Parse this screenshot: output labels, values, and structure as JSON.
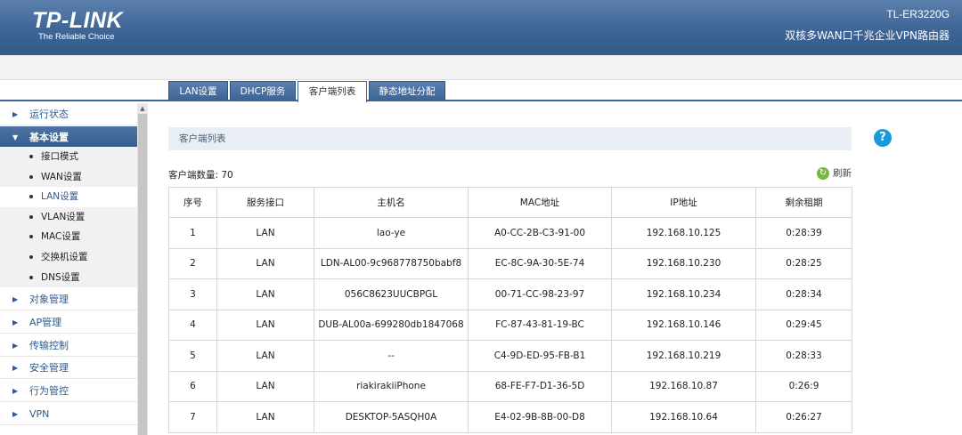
{
  "header": {
    "logo": "TP-LINK",
    "tagline": "The Reliable Choice",
    "model": "TL-ER3220G",
    "product": "双核多WAN口千兆企业VPN路由器"
  },
  "tabs": [
    {
      "label": "LAN设置",
      "active": false
    },
    {
      "label": "DHCP服务",
      "active": false
    },
    {
      "label": "客户端列表",
      "active": true
    },
    {
      "label": "静态地址分配",
      "active": false
    }
  ],
  "sidebar": {
    "items": [
      {
        "label": "运行状态"
      },
      {
        "label": "基本设置",
        "open": true,
        "children": [
          {
            "label": "接口模式"
          },
          {
            "label": "WAN设置"
          },
          {
            "label": "LAN设置",
            "selected": true
          },
          {
            "label": "VLAN设置"
          },
          {
            "label": "MAC设置"
          },
          {
            "label": "交换机设置"
          },
          {
            "label": "DNS设置"
          }
        ]
      },
      {
        "label": "对象管理"
      },
      {
        "label": "AP管理"
      },
      {
        "label": "传输控制"
      },
      {
        "label": "安全管理"
      },
      {
        "label": "行为管控"
      },
      {
        "label": "VPN"
      }
    ]
  },
  "panel": {
    "title": "客户端列表",
    "count_label": "客户端数量: 70",
    "refresh_label": "刷新",
    "help_icon": "?"
  },
  "table": {
    "columns": [
      "序号",
      "服务接口",
      "主机名",
      "MAC地址",
      "IP地址",
      "剩余租期"
    ],
    "rows": [
      [
        "1",
        "LAN",
        "lao-ye",
        "A0-CC-2B-C3-91-00",
        "192.168.10.125",
        "0:28:39"
      ],
      [
        "2",
        "LAN",
        "LDN-AL00-9c968778750babf8",
        "EC-8C-9A-30-5E-74",
        "192.168.10.230",
        "0:28:25"
      ],
      [
        "3",
        "LAN",
        "056C8623UUCBPGL",
        "00-71-CC-98-23-97",
        "192.168.10.234",
        "0:28:34"
      ],
      [
        "4",
        "LAN",
        "DUB-AL00a-699280db1847068",
        "FC-87-43-81-19-BC",
        "192.168.10.146",
        "0:29:45"
      ],
      [
        "5",
        "LAN",
        "--",
        "C4-9D-ED-95-FB-B1",
        "192.168.10.219",
        "0:28:33"
      ],
      [
        "6",
        "LAN",
        "riakirakiiPhone",
        "68-FE-F7-D1-36-5D",
        "192.168.10.87",
        "0:26:9"
      ],
      [
        "7",
        "LAN",
        "DESKTOP-5ASQH0A",
        "E4-02-9B-8B-00-D8",
        "192.168.10.64",
        "0:26:27"
      ]
    ]
  }
}
